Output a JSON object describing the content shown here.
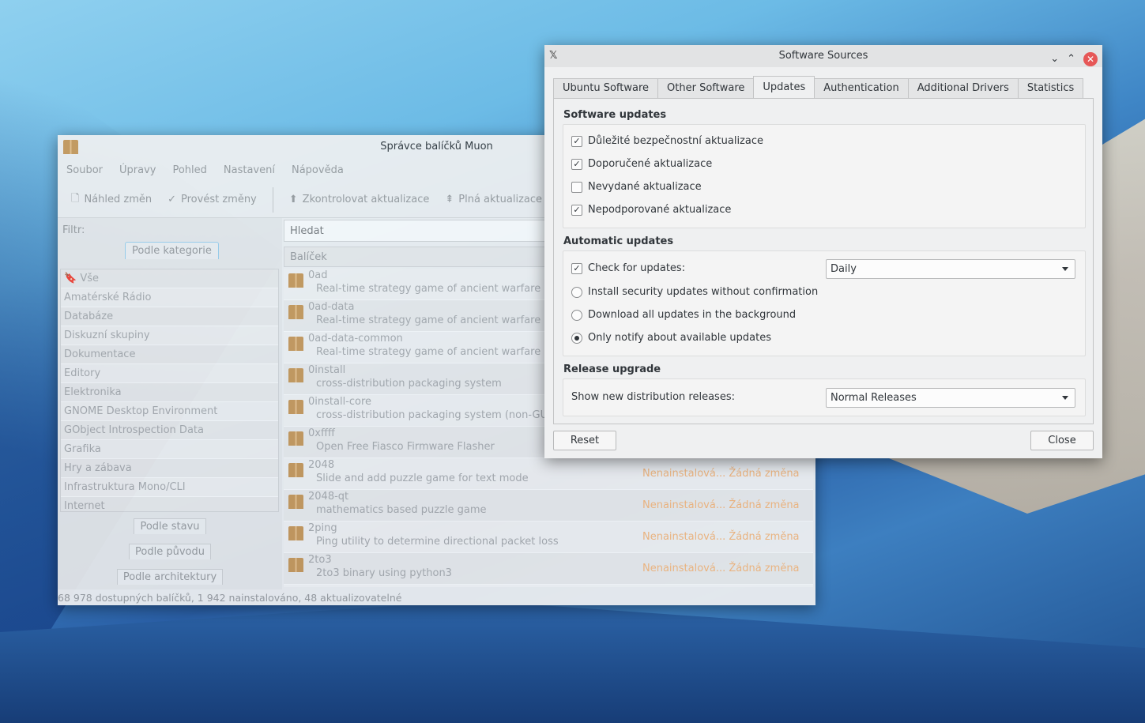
{
  "muon": {
    "title": "Správce balíčků Muon",
    "menu": [
      "Soubor",
      "Úpravy",
      "Pohled",
      "Nastavení",
      "Nápověda"
    ],
    "toolbar": {
      "preview": "Náhled změn",
      "apply": "Provést změny",
      "check": "Zkontrolovat aktualizace",
      "full": "Plná aktualizace"
    },
    "filter_label": "Filtr:",
    "tabs": {
      "category": "Podle kategorie",
      "status": "Podle stavu",
      "origin": "Podle původu",
      "arch": "Podle architektury"
    },
    "categories": [
      "Vše",
      "Amatérské Rádio",
      "Databáze",
      "Diskuzní skupiny",
      "Dokumentace",
      "Editory",
      "Elektronika",
      "GNOME Desktop Environment",
      "GObject Introspection Data",
      "Grafika",
      "Hry a zábava",
      "Infrastruktura Mono/CLI",
      "Internet"
    ],
    "search_placeholder": "Hledat",
    "column_header": "Balíček",
    "packages": [
      {
        "name": "0ad",
        "desc": "Real-time strategy game of ancient warfare",
        "status": ""
      },
      {
        "name": "0ad-data",
        "desc": "Real-time strategy game of ancient warfare (dat",
        "status": ""
      },
      {
        "name": "0ad-data-common",
        "desc": "Real-time strategy game of ancient warfare (co",
        "status": ""
      },
      {
        "name": "0install",
        "desc": "cross-distribution packaging system",
        "status": ""
      },
      {
        "name": "0install-core",
        "desc": "cross-distribution packaging system (non-GUI p",
        "status": ""
      },
      {
        "name": "0xffff",
        "desc": "Open Free Fiasco Firmware Flasher",
        "status": ""
      },
      {
        "name": "2048",
        "desc": "Slide and add puzzle game for text mode",
        "status": "Nenainstalová... Žádná změna"
      },
      {
        "name": "2048-qt",
        "desc": "mathematics based puzzle game",
        "status": "Nenainstalová... Žádná změna"
      },
      {
        "name": "2ping",
        "desc": "Ping utility to determine directional packet loss",
        "status": "Nenainstalová... Žádná změna"
      },
      {
        "name": "2to3",
        "desc": "2to3 binary using python3",
        "status": "Nenainstalová... Žádná změna"
      }
    ],
    "statusbar": "68 978 dostupných balíčků, 1 942 nainstalováno, 48 aktualizovatelné"
  },
  "dialog": {
    "title": "Software Sources",
    "tabs": [
      "Ubuntu Software",
      "Other Software",
      "Updates",
      "Authentication",
      "Additional Drivers",
      "Statistics"
    ],
    "active_tab": "Updates",
    "software_updates": {
      "heading": "Software updates",
      "items": [
        {
          "label": "Důležité bezpečnostní aktualizace",
          "checked": true
        },
        {
          "label": "Doporučené aktualizace",
          "checked": true
        },
        {
          "label": "Nevydané aktualizace",
          "checked": false
        },
        {
          "label": "Nepodporované aktualizace",
          "checked": true
        }
      ]
    },
    "automatic_updates": {
      "heading": "Automatic updates",
      "check_label": "Check for updates:",
      "check_checked": true,
      "frequency": "Daily",
      "options": [
        {
          "label": "Install security updates without confirmation",
          "selected": false
        },
        {
          "label": "Download all updates in the background",
          "selected": false
        },
        {
          "label": "Only notify about available updates",
          "selected": true
        }
      ]
    },
    "release_upgrade": {
      "heading": "Release upgrade",
      "label": "Show new distribution releases:",
      "value": "Normal Releases"
    },
    "reset": "Reset",
    "close": "Close"
  },
  "colors": {
    "status_orange": "#f7b87c",
    "close_red": "#e65757"
  }
}
